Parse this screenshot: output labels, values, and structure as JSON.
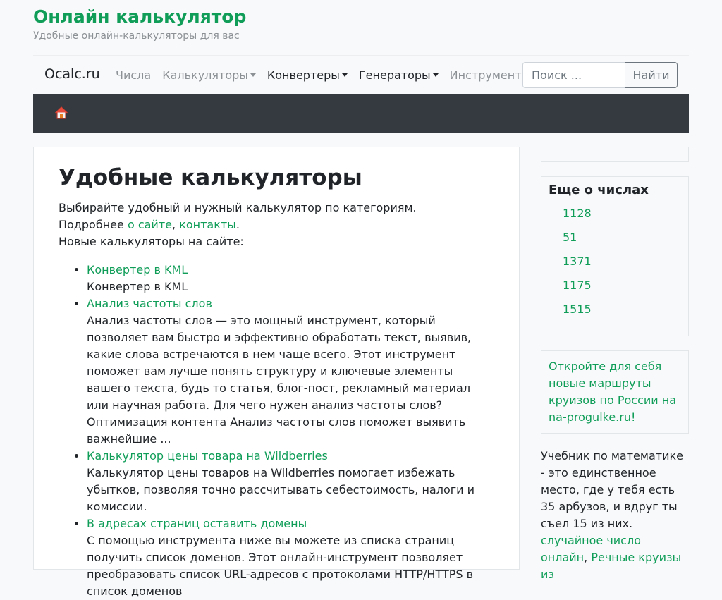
{
  "header": {
    "title": "Онлайн калькулятор",
    "subtitle": "Удобные онлайн-калькуляторы для вас"
  },
  "navbar": {
    "brand": "Ocalc.ru",
    "items": [
      {
        "label": "Числа",
        "dropdown": false
      },
      {
        "label": "Калькуляторы",
        "dropdown": true
      },
      {
        "label": "Конвертеры",
        "dropdown": true
      },
      {
        "label": "Генераторы",
        "dropdown": true
      },
      {
        "label": "Инструменты",
        "dropdown": true
      }
    ],
    "search_placeholder": "Поиск ...",
    "search_button": "Найти"
  },
  "breadcrumb": {
    "home_icon": "home-icon"
  },
  "main": {
    "title": "Удобные калькуляторы",
    "intro": "Выбирайте удобный и нужный калькулятор по категориям.",
    "more_prefix": "Подробнее ",
    "about_link": "о сайте",
    "comma": ", ",
    "contacts_link": "контакты",
    "period": ".",
    "new_label": "Новые калькуляторы на сайте:",
    "items": [
      {
        "title": "Конвертер в KML",
        "desc": "Конвертер в KML"
      },
      {
        "title": "Анализ частоты слов",
        "desc": "Анализ частоты слов — это мощный инструмент, который позволяет вам быстро и эффективно обработать текст, выявив, какие слова встречаются в нем чаще всего. Этот инструмент поможет вам лучше понять структуру и ключевые элементы вашего текста, будь то статья, блог-пост, рекламный материал или научная работа. Для чего нужен анализ частоты слов? Оптимизация контента Анализ частоты слов поможет выявить важнейшие ..."
      },
      {
        "title": "Калькулятор цены товара на Wildberries",
        "desc": "Калькулятор цены товаров на Wildberries помогает избежать убытков, позволяя точно рассчитывать себестоимость, налоги и комиссии."
      },
      {
        "title": "В адресах страниц оставить домены",
        "desc": "С помощью инструмента ниже вы можете из списка страниц получить список доменов. Этот онлайн-инструмент позволяет преобразовать список URL-адресов с протоколами HTTP/HTTPS в список доменов"
      }
    ]
  },
  "sidebar": {
    "numbers_title": "Еще о числах",
    "numbers": [
      "1128",
      "51",
      "1371",
      "1175",
      "1515"
    ],
    "ad_text": "Откройте для себя новые маршруты круизов по России на na-progulke.ru!",
    "textbook_text": "Учебник по математике - это единственное место, где у тебя есть 35 арбузов, и вдруг ты съел 15 из них. ",
    "random_link": "случайное число онлайн",
    "comma": ",",
    "rivers_link": "Речные круизы из"
  },
  "colors": {
    "accent": "#0f9d58",
    "dark_bar": "#343a40"
  }
}
